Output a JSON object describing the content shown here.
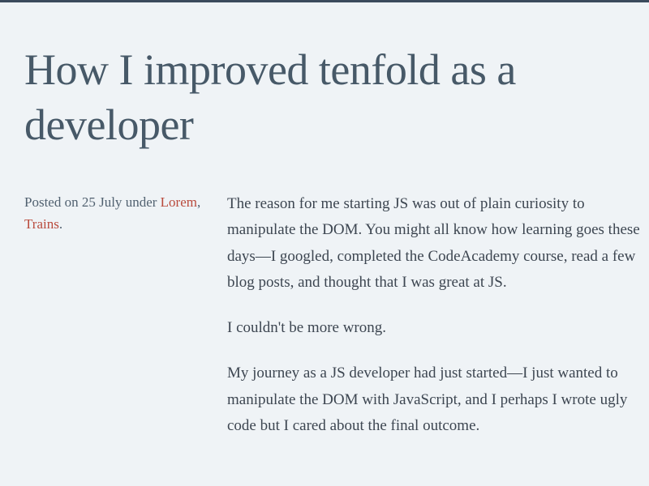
{
  "article": {
    "title": "How I improved tenfold as a developer",
    "meta": {
      "prefix": "Posted on ",
      "date": "25 July",
      "under_text": " under ",
      "categories": [
        {
          "label": "Lorem"
        },
        {
          "label": "Trains"
        }
      ],
      "separator": ", ",
      "suffix": "."
    },
    "paragraphs": [
      "The reason for me starting JS was out of plain curiosity to manipulate the DOM. You might all know how learning goes these days—I googled, completed the CodeAcademy course, read a few blog posts, and thought that I was great at JS.",
      "I couldn't be more wrong.",
      "My journey as a JS developer had just started—I just wanted to manipulate the DOM with JavaScript, and I perhaps I wrote ugly code but I cared about the final outcome."
    ]
  }
}
